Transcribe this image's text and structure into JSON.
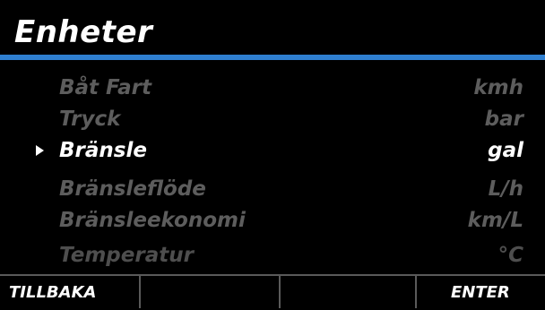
{
  "header": {
    "title": "Enheter",
    "accent_color": "#2f7fd0"
  },
  "menu": {
    "selected_index": 2,
    "items": [
      {
        "label": "Båt Fart",
        "value": "kmh"
      },
      {
        "label": "Tryck",
        "value": "bar"
      },
      {
        "label": "Bränsle",
        "value": "gal"
      },
      {
        "label": "Bränsleflöde",
        "value": "L/h"
      },
      {
        "label": "Bränsleekonomi",
        "value": "km/L"
      },
      {
        "label": "Temperatur",
        "value": "°C"
      }
    ],
    "selector_icon": "triangle-right-icon"
  },
  "softkeys": {
    "left": "TILLBAKA",
    "center_left": "",
    "center_right": "",
    "right": "ENTER"
  }
}
